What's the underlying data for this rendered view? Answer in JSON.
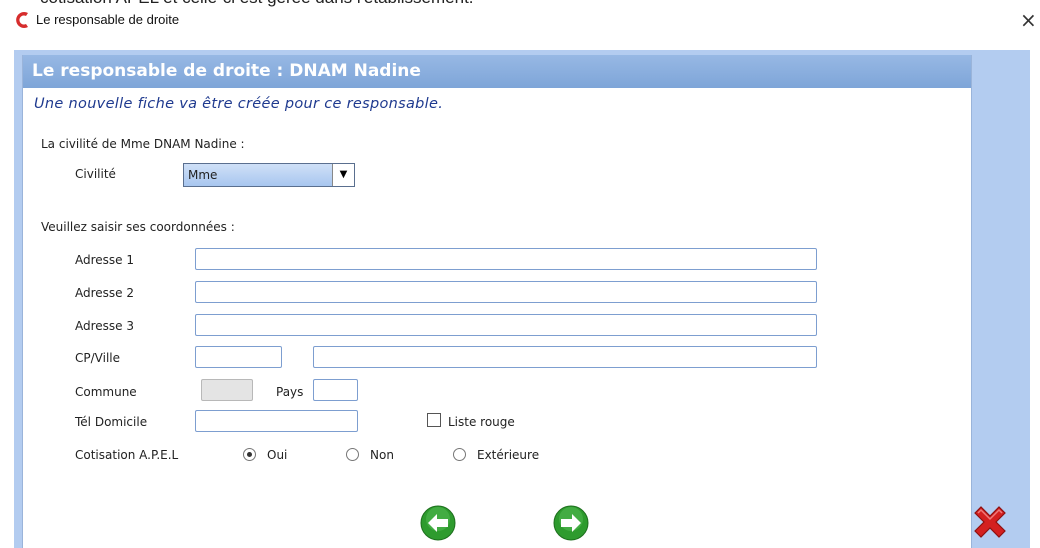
{
  "top_cut_text": "cotisation APEL et celle-ci est gérée dans l'établissement.",
  "window": {
    "title": "Le responsable de droite",
    "close_label": "×"
  },
  "panel": {
    "header": "Le responsable de droite : DNAM Nadine",
    "intro": "Une nouvelle fiche va être créée pour ce responsable."
  },
  "civility": {
    "section_label": "La civilité de Mme DNAM Nadine :",
    "label": "Civilité",
    "value": "Mme"
  },
  "coords": {
    "section_label": "Veuillez saisir ses coordonnées :",
    "adresse1_label": "Adresse 1",
    "adresse2_label": "Adresse 2",
    "adresse3_label": "Adresse 3",
    "cpville_label": "CP/Ville",
    "commune_label": "Commune",
    "pays_label": "Pays",
    "tel_label": "Tél Domicile",
    "liste_rouge_label": "Liste rouge",
    "liste_rouge_checked": false,
    "cotisation_label": "Cotisation A.P.E.L",
    "cotisation_options": [
      "Oui",
      "Non",
      "Extérieure"
    ],
    "cotisation_selected": "Oui"
  },
  "icons": {
    "app": "app-logo-icon",
    "back": "arrow-left-icon",
    "next": "arrow-right-icon",
    "cancel": "red-x-icon"
  },
  "colors": {
    "header_bg": "#88ade0",
    "intro_text": "#1f3a8f",
    "nav_green": "#2e9b2e",
    "cancel_red": "#d42020"
  }
}
